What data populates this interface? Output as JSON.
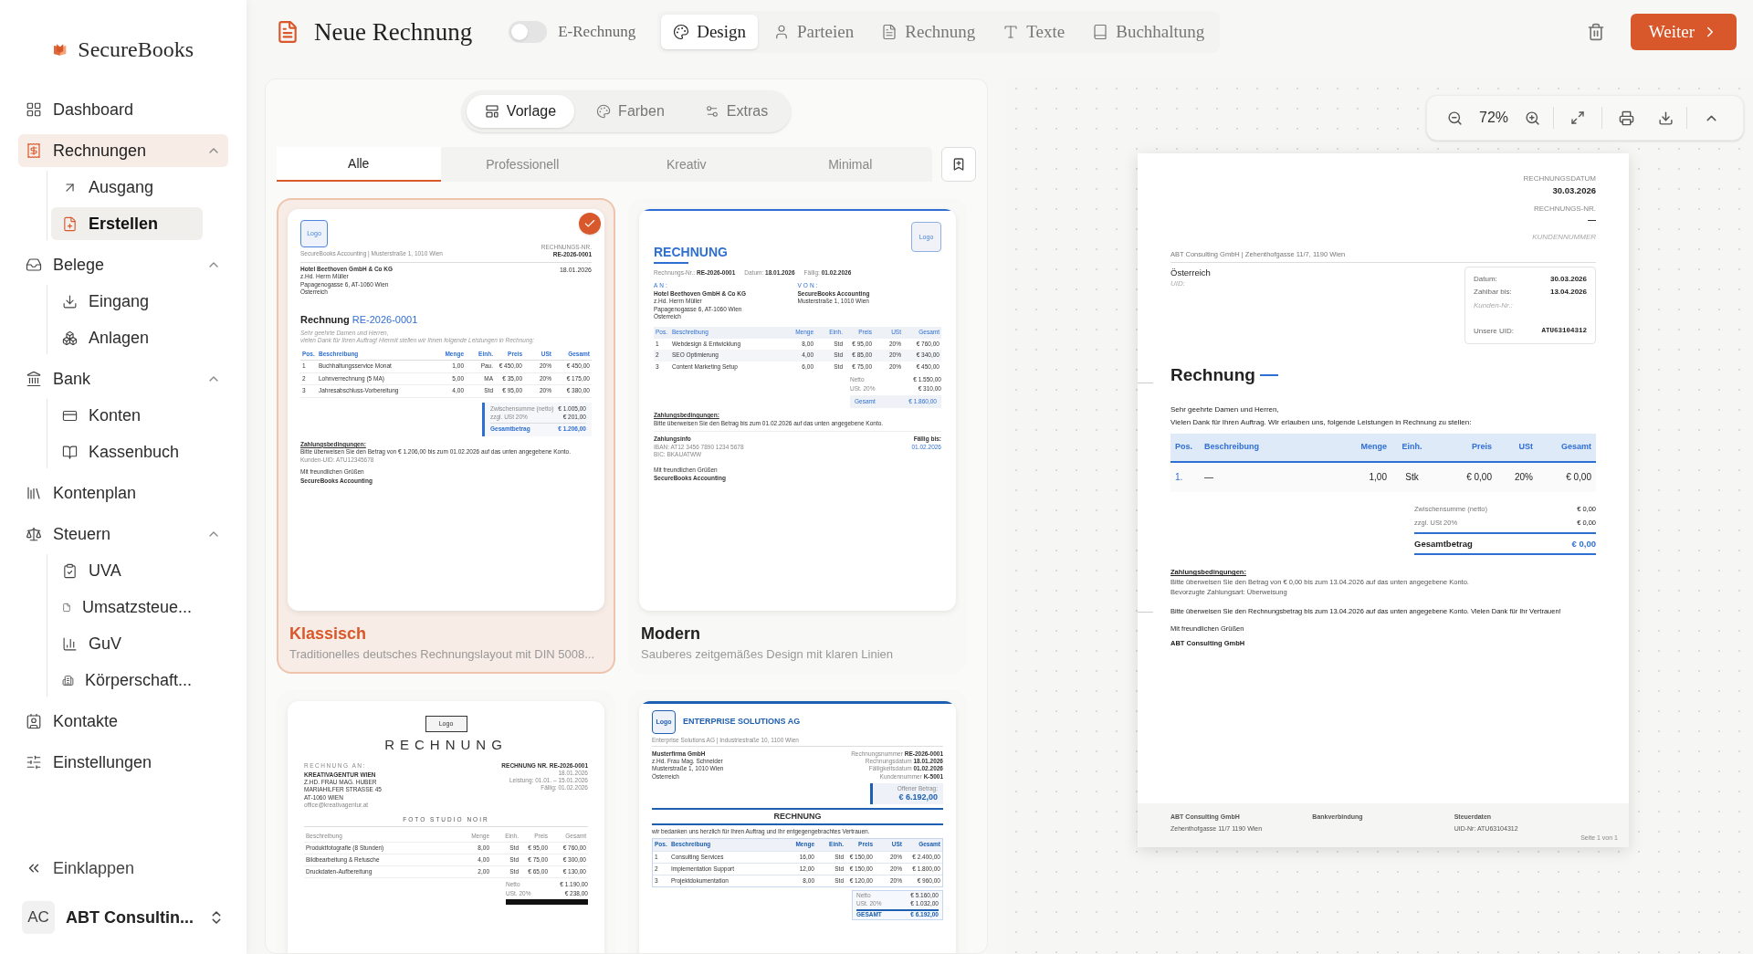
{
  "sidebar": {
    "brand": "SecureBooks",
    "items": [
      {
        "label": "Dashboard",
        "selected": false
      },
      {
        "label": "Rechnungen",
        "selected": true,
        "expanded": true,
        "children": [
          {
            "label": "Ausgang",
            "selected": false
          },
          {
            "label": "Erstellen",
            "selected": true
          }
        ]
      },
      {
        "label": "Belege",
        "selected": false,
        "expanded": true,
        "children": [
          {
            "label": "Eingang",
            "selected": false
          },
          {
            "label": "Anlagen",
            "selected": false
          }
        ]
      },
      {
        "label": "Bank",
        "selected": false,
        "expanded": true,
        "children": [
          {
            "label": "Konten",
            "selected": false
          },
          {
            "label": "Kassenbuch",
            "selected": false
          }
        ]
      },
      {
        "label": "Kontenplan",
        "selected": false
      },
      {
        "label": "Steuern",
        "selected": false,
        "expanded": true,
        "children": [
          {
            "label": "UVA",
            "selected": false
          },
          {
            "label": "Umsatzsteue...",
            "selected": false
          },
          {
            "label": "GuV",
            "selected": false
          },
          {
            "label": "Körperschaft...",
            "selected": false
          }
        ]
      },
      {
        "label": "Kontakte",
        "selected": false
      },
      {
        "label": "Einstellungen",
        "selected": false
      }
    ],
    "collapse": "Einklappen",
    "account": {
      "initials": "AC",
      "name": "ABT Consultin..."
    }
  },
  "top_bar": {
    "title": "Neue Rechnung",
    "e_rechnung": {
      "label": "E-Rechnung",
      "on": false
    },
    "tabs": [
      {
        "label": "Design",
        "selected": true
      },
      {
        "label": "Parteien",
        "selected": false
      },
      {
        "label": "Rechnung",
        "selected": false
      },
      {
        "label": "Texte",
        "selected": false
      },
      {
        "label": "Buchhaltung",
        "selected": false
      }
    ],
    "next_button": "Weiter"
  },
  "design_panel": {
    "modes": [
      {
        "label": "Vorlage",
        "selected": true
      },
      {
        "label": "Farben",
        "selected": false
      },
      {
        "label": "Extras",
        "selected": false
      }
    ],
    "categories": [
      {
        "label": "Alle",
        "selected": true
      },
      {
        "label": "Professionell",
        "selected": false
      },
      {
        "label": "Kreativ",
        "selected": false
      },
      {
        "label": "Minimal",
        "selected": false
      }
    ],
    "templates": [
      {
        "kind": "classic",
        "name": "Klassisch",
        "description": "Traditionelles deutsches Rechnungslayout mit DIN 5008...",
        "selected": true,
        "preview": {
          "logo": "Logo",
          "label_number": "RECHNUNGS-NR.",
          "number": "RE-2026-0001",
          "date": "18.01.2026",
          "sender": "SecureBooks Accounting | Musterstraße 1, 1010 Wien",
          "recipient": [
            "Hotel Beethoven GmbH & Co KG",
            "z.Hd. Herrn Müller",
            "Papagenogasse 6, AT-1060 Wien",
            "Österreich"
          ],
          "title": "Rechnung",
          "title_number": "RE-2026-0001",
          "greeting": [
            "Sehr geehrte Damen und Herren,",
            "vielen Dank für Ihren Auftrag! Hiermit stellen wir Ihnen folgende Leistungen in Rechnung:"
          ],
          "columns": [
            "Pos.",
            "Beschreibung",
            "Menge",
            "Einh.",
            "Preis",
            "USt",
            "Gesamt"
          ],
          "rows": [
            [
              "1",
              "Buchhaltungsservice Monat",
              "1,00",
              "Pau.",
              "€ 450,00",
              "20%",
              "€ 450,00"
            ],
            [
              "2",
              "Lohnverrechnung (5 MA)",
              "5,00",
              "MA",
              "€ 35,00",
              "20%",
              "€ 175,00"
            ],
            [
              "3",
              "Jahresabschluss-Vorbereitung",
              "4,00",
              "Std",
              "€ 95,00",
              "20%",
              "€ 380,00"
            ]
          ],
          "totals": [
            [
              "Zwischensumme (netto)",
              "€ 1.005,00"
            ],
            [
              "zzgl. USt 20%",
              "€ 201,00"
            ]
          ],
          "total": [
            "Gesamtbetrag",
            "€ 1.206,00"
          ],
          "terms_title": "Zahlungsbedingungen:",
          "terms": [
            "Bitte überweisen Sie den Betrag von € 1.206,00 bis zum 01.02.2026 auf das unten angegebene Konto.",
            "Kunden-UID: ATU12345678"
          ],
          "closing": [
            "Mit freundlichen Grüßen",
            "SecureBooks Accounting"
          ]
        }
      },
      {
        "kind": "modern",
        "name": "Modern",
        "description": "Sauberes zeitgemäßes Design mit klaren Linien",
        "selected": false,
        "preview": {
          "logo": "Logo",
          "title": "RECHNUNG",
          "meta": [
            [
              "Rechnungs-Nr.:",
              "RE-2026-0001"
            ],
            [
              "Datum:",
              "18.01.2026"
            ],
            [
              "Fällig:",
              "01.02.2026"
            ]
          ],
          "to_label": "AN:",
          "recipient": [
            "Hotel Beethoven GmbH & Co KG",
            "z.Hd. Herrn Müller",
            "Papagenogasse 6, AT-1060 Wien",
            "Österreich"
          ],
          "from_label": "VON:",
          "sender": [
            "SecureBooks Accounting",
            "Musterstraße 1, 1010 Wien"
          ],
          "columns": [
            "Pos.",
            "Beschreibung",
            "Menge",
            "Einh.",
            "Preis",
            "USt",
            "Gesamt"
          ],
          "rows": [
            [
              "1",
              "Webdesign & Entwicklung",
              "8,00",
              "Std",
              "€ 95,00",
              "20%",
              "€ 760,00"
            ],
            [
              "2",
              "SEO Optimierung",
              "4,00",
              "Std",
              "€ 85,00",
              "20%",
              "€ 340,00"
            ],
            [
              "3",
              "Content Marketing Setup",
              "6,00",
              "Std",
              "€ 75,00",
              "20%",
              "€ 450,00"
            ]
          ],
          "totals": [
            [
              "Netto",
              "€ 1.550,00"
            ],
            [
              "USt. 20%",
              "€ 310,00"
            ]
          ],
          "total": [
            "Gesamt",
            "€ 1.860,00"
          ],
          "terms_title": "Zahlungsbedingungen:",
          "terms": [
            "Bitte überweisen Sie den Betrag bis zum 01.02.2026 auf das unten angegebene Konto."
          ],
          "payment_title": "Zahlungsinfo",
          "payment": [
            "IBAN: AT12 3456 7890 1234 5678",
            "BIC: BKAUATWW"
          ],
          "due_label": "Fällig bis:",
          "due": "01.02.2026",
          "closing": [
            "Mit freundlichen Grüßen",
            "SecureBooks Accounting"
          ]
        }
      },
      {
        "kind": "elegant",
        "selected": false,
        "preview": {
          "logo": "Logo",
          "title": "RECHNUNG",
          "to_label": "RECHNUNG AN:",
          "recipient": [
            "KREATIVAGENTUR WIEN",
            "Z.HD. FRAU MAG. HUBER",
            "MARIAHILFER STRASSE 45",
            "AT-1060 WIEN"
          ],
          "email": "office@kreativagentur.at",
          "number": "RECHNUNG NR. RE-2026-0001",
          "meta": [
            "18.01.2026",
            "Leistung: 01.01. – 15.01.2026",
            "Fällig: 01.02.2026"
          ],
          "studio": "FOTO STUDIO NOIR",
          "columns": [
            "Beschreibung",
            "Menge",
            "Einh.",
            "Preis",
            "Gesamt"
          ],
          "rows": [
            [
              "Produktfotografie (8 Stunden)",
              "8,00",
              "Std",
              "€ 95,00",
              "€ 760,00"
            ],
            [
              "Bildbearbeitung & Retusche",
              "4,00",
              "Std",
              "€ 75,00",
              "€ 300,00"
            ],
            [
              "Druckdaten-Aufbereitung",
              "2,00",
              "Std",
              "€ 65,00",
              "€ 130,00"
            ]
          ],
          "totals": [
            [
              "Netto",
              "€ 1.190,00"
            ],
            [
              "USt. 20%",
              "€ 238,00"
            ]
          ]
        }
      },
      {
        "kind": "corporate",
        "selected": false,
        "preview": {
          "logo": "Logo",
          "company": "ENTERPRISE SOLUTIONS AG",
          "sender": "Enterprise Solutions AG | Industriestraße 10, 1100 Wien",
          "recipient": [
            "Musterfirma GmbH",
            "z.Hd. Frau Mag. Schneider",
            "Musterstraße 1, 1010 Wien",
            "Österreich"
          ],
          "meta": [
            [
              "Rechnungsnummer",
              "RE-2026-0001"
            ],
            [
              "Rechnungsdatum",
              "18.01.2026"
            ],
            [
              "Fälligkeitsdatum",
              "01.02.2026"
            ],
            [
              "Kundennummer",
              "K-5001"
            ]
          ],
          "open_label": "Offener Betrag:",
          "open_amount": "€ 6.192,00",
          "title": "RECHNUNG",
          "intro": "wir bedanken uns herzlich für Ihren Auftrag und Ihr entgegengebrachtes Vertrauen.",
          "columns": [
            "Pos.",
            "Beschreibung",
            "Menge",
            "Einh.",
            "Preis",
            "USt",
            "Gesamt"
          ],
          "rows": [
            [
              "1",
              "Consulting Services",
              "16,00",
              "Std",
              "€ 150,00",
              "20%",
              "€ 2.400,00"
            ],
            [
              "2",
              "Implementation Support",
              "12,00",
              "Std",
              "€ 150,00",
              "20%",
              "€ 1.800,00"
            ],
            [
              "3",
              "Projektdokumentation",
              "8,00",
              "Std",
              "€ 120,00",
              "20%",
              "€ 960,00"
            ]
          ],
          "totals": [
            [
              "Netto",
              "€ 5.160,00"
            ],
            [
              "USt. 20%",
              "€ 1.032,00"
            ]
          ],
          "total": [
            "GESAMT",
            "€ 6.192,00"
          ]
        }
      }
    ]
  },
  "preview": {
    "zoom": "72%",
    "document": {
      "label_date": "RECHNUNGSDATUM",
      "date": "30.03.2026",
      "label_number": "RECHNUNGS-NR.",
      "number": "—",
      "label_customer": "KUNDENNUMMER",
      "sender_line": "ABT Consulting GmbH | Zehenthofgasse 11/7, 1190 Wien",
      "country": "Österreich",
      "uid_placeholder": "UID:",
      "info": [
        {
          "label": "Datum:",
          "value": "30.03.2026"
        },
        {
          "label": "Zahlbar bis:",
          "value": "13.04.2026"
        },
        {
          "label": "Kunden-Nr.:"
        },
        {
          "label": "Unsere UID:",
          "value": "ATU63104312"
        }
      ],
      "title": "Rechnung",
      "greeting": "Sehr geehrte Damen und Herren,",
      "intro": "Vielen Dank für Ihren Auftrag. Wir erlauben uns, folgende Leistungen in Rechnung zu stellen:",
      "columns": [
        "Pos.",
        "Beschreibung",
        "Menge",
        "Einh.",
        "Preis",
        "USt",
        "Gesamt"
      ],
      "rows": [
        [
          "1.",
          "—",
          "1,00",
          "Stk",
          "€ 0,00",
          "20%",
          "€ 0,00"
        ]
      ],
      "totals": [
        [
          "Zwischensumme (netto)",
          "€ 0,00"
        ],
        [
          "zzgl. USt 20%",
          "€ 0,00"
        ]
      ],
      "total": [
        "Gesamtbetrag",
        "€ 0,00"
      ],
      "terms_title": "Zahlungsbedingungen:",
      "terms": [
        "Bitte überweisen Sie den Betrag von € 0,00 bis zum 13.04.2026 auf das unten angegebene Konto.",
        "Bevorzugte Zahlungsart: Überweisung"
      ],
      "note": "Bitte überweisen Sie den Rechnungsbetrag bis zum 13.04.2026 auf das unten angegebene Konto. Vielen Dank für Ihr Vertrauen!",
      "closing": [
        "Mit freundlichen Grüßen",
        "ABT Consulting GmbH"
      ],
      "footer": [
        {
          "title": "ABT Consulting GmbH",
          "text": "Zehenthofgasse 11/7 1190 Wien"
        },
        {
          "title": "Bankverbindung"
        },
        {
          "title": "Steuerdaten",
          "text": "UID-Nr: ATU63104312"
        }
      ],
      "page": "Seite 1 von 1"
    }
  }
}
